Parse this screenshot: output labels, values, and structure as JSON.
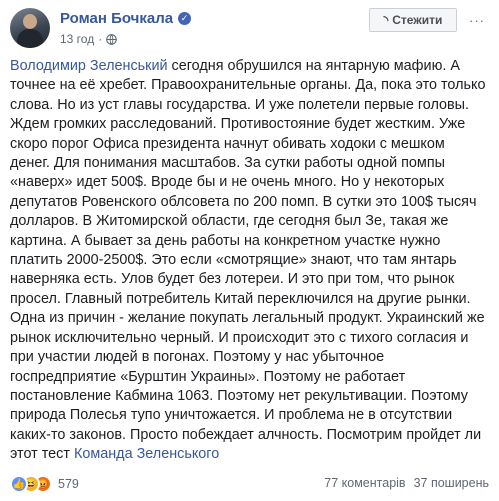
{
  "post": {
    "author": "Роман Бочкала",
    "time": "13 год",
    "follow_label": "Стежити",
    "more_label": "···",
    "text_lines": [
      [
        "Володимир Зеленський",
        " сегодня обрушился на янтарную мафию. А"
      ],
      [
        "",
        "точнее на её хребет. Правоохранительные органы. Да, пока это только"
      ],
      [
        "",
        "слова. Но из уст главы государства. И уже полетели первые головы."
      ],
      [
        "",
        "Ждем громких расследований. Противостояние будет жестким. Уже"
      ],
      [
        "",
        "скоро порог Офиса президента начнут обивать ходоки с мешком"
      ],
      [
        "",
        "денег. Для понимания масштабов. За сутки работы одной помпы"
      ],
      [
        "",
        "«наверх» идет 500$. Вроде бы и не очень много. Но у некоторых"
      ],
      [
        "",
        "депутатов Ровенского облсовета по 200 помп. В сутки это 100$ тысяч"
      ],
      [
        "",
        "долларов. В Житомирской области, где сегодня был Зе, такая же"
      ],
      [
        "",
        "картина. А бывает за день работы на конкретном участке нужно"
      ],
      [
        "",
        "платить 2000-2500$. Это если «смотрящие» знают, что там янтарь"
      ],
      [
        "",
        "наверняка есть. Улов будет без лотереи. И это при том, что рынок"
      ],
      [
        "",
        "просел. Главный потребитель Китай переключился на другие рынки."
      ],
      [
        "",
        "Одна из причин - желание покупать легальный продукт. Украинский же"
      ],
      [
        "",
        "рынок исключительно черный. И происходит это с тихого согласия и"
      ],
      [
        "",
        "при участии людей в погонах. Поэтому у нас убыточное"
      ],
      [
        "",
        "госпредприятие «Бурштин Украины». Поэтому не работает"
      ],
      [
        "",
        "постановление Кабмина 1063. Поэтому нет рекультивации. Поэтому"
      ],
      [
        "",
        "природа Полесья тупо уничтожается. И проблема не в отсутствии"
      ],
      [
        "",
        "каких-то законов. Просто побеждает алчность. Посмотрим пройдет ли"
      ],
      [
        "этот тест ",
        "Команда Зеленського"
      ]
    ]
  },
  "footer": {
    "reactions": [
      "like",
      "haha",
      "angry"
    ],
    "reaction_count": "579",
    "comments": "77 коментарів",
    "shares": "37 поширень"
  },
  "colors": {
    "link": "#385898",
    "like": "#5890ff",
    "haha": "#f7b125",
    "angry": "#e9710f"
  }
}
